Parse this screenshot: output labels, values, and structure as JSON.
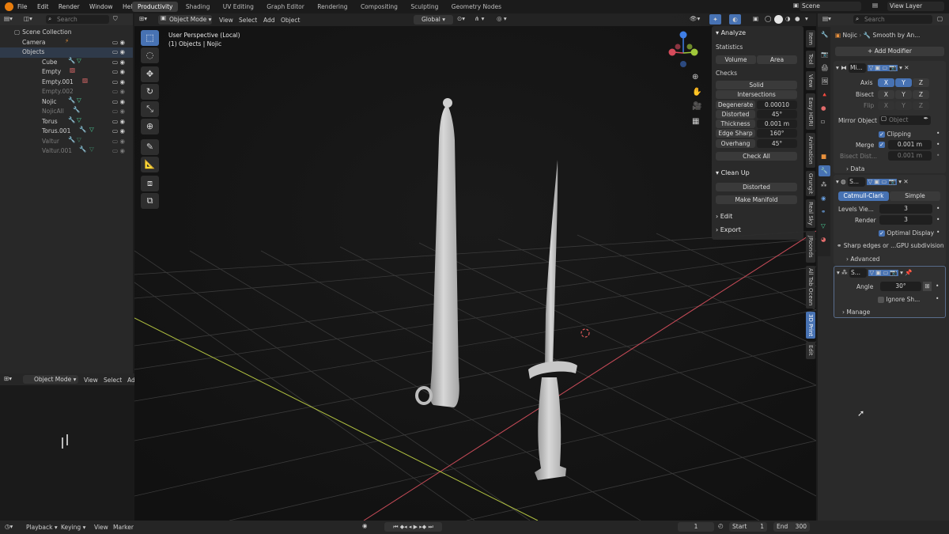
{
  "menu": [
    "File",
    "Edit",
    "Render",
    "Window",
    "Help"
  ],
  "workspaces": [
    "Productivity",
    "Shading",
    "UV Editing",
    "Graph Editor",
    "Rendering",
    "Compositing",
    "Sculpting",
    "Geometry Nodes"
  ],
  "active_workspace": "Productivity",
  "scene": "Scene",
  "view_layer": "View Layer",
  "outliner": {
    "search_placeholder": "Search",
    "rows": [
      {
        "label": "Scene Collection",
        "dim": false
      },
      {
        "label": "Camera",
        "dim": false
      },
      {
        "label": "Objects",
        "dim": false
      },
      {
        "label": "Cube",
        "dim": false
      },
      {
        "label": "Empty",
        "dim": false
      },
      {
        "label": "Empty.001",
        "dim": false
      },
      {
        "label": "Empty.002",
        "dim": true
      },
      {
        "label": "Nojic",
        "dim": false
      },
      {
        "label": "NojicAll",
        "dim": true
      },
      {
        "label": "Torus",
        "dim": false
      },
      {
        "label": "Torus.001",
        "dim": false
      },
      {
        "label": "Valtur",
        "dim": true
      },
      {
        "label": "Valtur.001",
        "dim": true
      }
    ]
  },
  "viewport": {
    "mode": "Object Mode",
    "menus": [
      "View",
      "Select",
      "Add",
      "Object"
    ],
    "orientation": "Global",
    "title": "User Perspective (Local)",
    "subtitle": "(1) Objects | Nojic"
  },
  "mini_view": {
    "mode": "Object Mode",
    "menus": [
      "View",
      "Select",
      "Ad"
    ]
  },
  "print3d": {
    "analyze": "Analyze",
    "statistics": "Statistics",
    "volume": "Volume",
    "area": "Area",
    "checks": "Checks",
    "solid": "Solid",
    "intersections": "Intersections",
    "rows": [
      {
        "label": "Degenerate",
        "value": "0.00010"
      },
      {
        "label": "Distorted",
        "value": "45°"
      },
      {
        "label": "Thickness",
        "value": "0.001 m"
      },
      {
        "label": "Edge Sharp",
        "value": "160°"
      },
      {
        "label": "Overhang",
        "value": "45°"
      }
    ],
    "check_all": "Check All",
    "clean_up": "Clean Up",
    "distorted_btn": "Distorted",
    "make_manifold": "Make Manifold",
    "edit": "Edit",
    "export": "Export"
  },
  "side_tabs": [
    "Item",
    "Tool",
    "View",
    "Easy HDRI",
    "Animation",
    "Grungit",
    "Real Sky",
    "JRoonds",
    "All Tab Ocean",
    "3D Print",
    "Edit"
  ],
  "active_side_tab": "3D Print",
  "properties": {
    "search_placeholder": "Search",
    "breadcrumb_obj": "Nojic",
    "breadcrumb_mod": "Smooth by An...",
    "add_modifier": "Add Modifier",
    "mirror": {
      "name": "Mi...",
      "axis": "Axis",
      "bisect": "Bisect",
      "flip": "Flip",
      "xyz": [
        "X",
        "Y",
        "Z"
      ],
      "mirror_object": "Mirror Object",
      "object_placeholder": "Object",
      "clipping": "Clipping",
      "merge": "Merge",
      "merge_value": "0.001 m",
      "bisect_dist": "Bisect Dist...",
      "bisect_value": "0.001 m",
      "data": "Data"
    },
    "subsurf": {
      "name": "S...",
      "catmull": "Catmull-Clark",
      "simple": "Simple",
      "levels_label": "Levels Vie...",
      "levels_value": "3",
      "render_label": "Render",
      "render_value": "3",
      "optimal": "Optimal Display",
      "note": "Sharp edges or ...GPU subdivision",
      "advanced": "Advanced"
    },
    "smooth": {
      "name": "S...",
      "angle_label": "Angle",
      "angle_value": "30°",
      "ignore": "Ignore Sh...",
      "manage": "Manage"
    }
  },
  "timeline": {
    "menus": [
      "Playback",
      "Keying",
      "View",
      "Marker"
    ],
    "current_frame": "1",
    "start_label": "Start",
    "start": "1",
    "end_label": "End",
    "end": "300"
  },
  "colors": {
    "accent": "#4772b3",
    "x_axis": "#d64b5b",
    "y_axis": "#a0c83a",
    "z_axis": "#3f7ee6"
  }
}
